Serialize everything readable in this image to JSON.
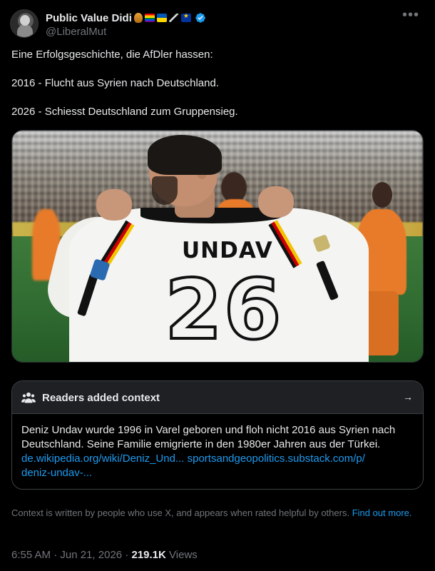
{
  "author": {
    "display_name": "Public Value Didi",
    "handle": "@LiberalMut",
    "flair_emojis": [
      "hotdog-icon",
      "rainbow-flag-icon",
      "ukraine-flag-icon",
      "syringe-icon",
      "eu-flag-icon"
    ],
    "verified": true
  },
  "more_menu_label": "•••",
  "tweet": {
    "lines": [
      "Eine Erfolgsgeschichte, die AfDler hassen:",
      "2016 - Flucht aus Syrien nach Deutschland.",
      "2026 - Schiesst Deutschland zum Gruppensieg."
    ]
  },
  "media": {
    "jersey_name": "UNDAV",
    "jersey_number": "26"
  },
  "community_note": {
    "title": "Readers added context",
    "body": "Deniz Undav wurde 1996 in Varel geboren und floh nicht 2016 aus Syrien nach Deutschland. Seine Familie emigrierte in den 1980er Jahren aus der Türkei.",
    "link1": "de.wikipedia.org/wiki/Deniz_Und...",
    "link2": "sportsandgeopolitics.substack.com/p/",
    "link2_cont": "deniz-undav-...",
    "footnote": "Context is written by people who use X, and appears when rated helpful by others.",
    "footnote_link": "Find out more."
  },
  "meta": {
    "time": "6:55 AM",
    "separator": "·",
    "date": "Jun 21, 2026",
    "views_count": "219.1K",
    "views_label": "Views"
  },
  "colors": {
    "background": "#000000",
    "text": "#e7e9ea",
    "muted": "#71767b",
    "link": "#1d9bf0",
    "note_header": "#1e2024"
  }
}
